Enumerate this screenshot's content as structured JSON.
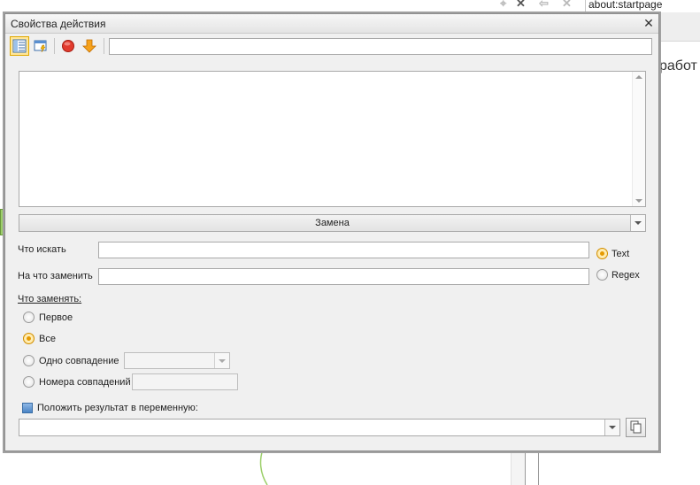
{
  "background": {
    "address_text": "about:startpage",
    "work_text": "работ",
    "nav": {
      "pin": "⌖",
      "close": "✕",
      "back": "⇦",
      "stop": "✕"
    }
  },
  "dialog": {
    "title": "Свойства действия",
    "close_glyph": "✕",
    "toolbar": {
      "buttons": [
        {
          "icon": "properties-list-icon",
          "active": true
        },
        {
          "icon": "window-lightning-icon",
          "active": false
        },
        {
          "icon": "stop-red-circle-icon",
          "active": false
        },
        {
          "icon": "orange-down-arrow-icon",
          "active": false
        }
      ],
      "input_value": ""
    },
    "textarea_value": "",
    "mode_select": {
      "selected": "Замена"
    },
    "find_label": "Что искать",
    "find_value": "",
    "replace_label": "На что заменить",
    "replace_value": "",
    "match_type": {
      "options": [
        "Text",
        "Regex"
      ],
      "selected": "Text"
    },
    "what_replace": {
      "title": "Что заменять:",
      "options": [
        "Первое",
        "Все",
        "Одно совпадение",
        "Номера совпадений"
      ],
      "selected": "Все",
      "one_match_value": "",
      "match_numbers_value": ""
    },
    "result_var": {
      "label": "Положить результат в переменную:",
      "checked": true,
      "value": ""
    }
  },
  "colors": {
    "accent_orange": "#e69a00",
    "checkbox_blue": "#4a84c4",
    "dialog_bg": "#f0f0f0"
  }
}
